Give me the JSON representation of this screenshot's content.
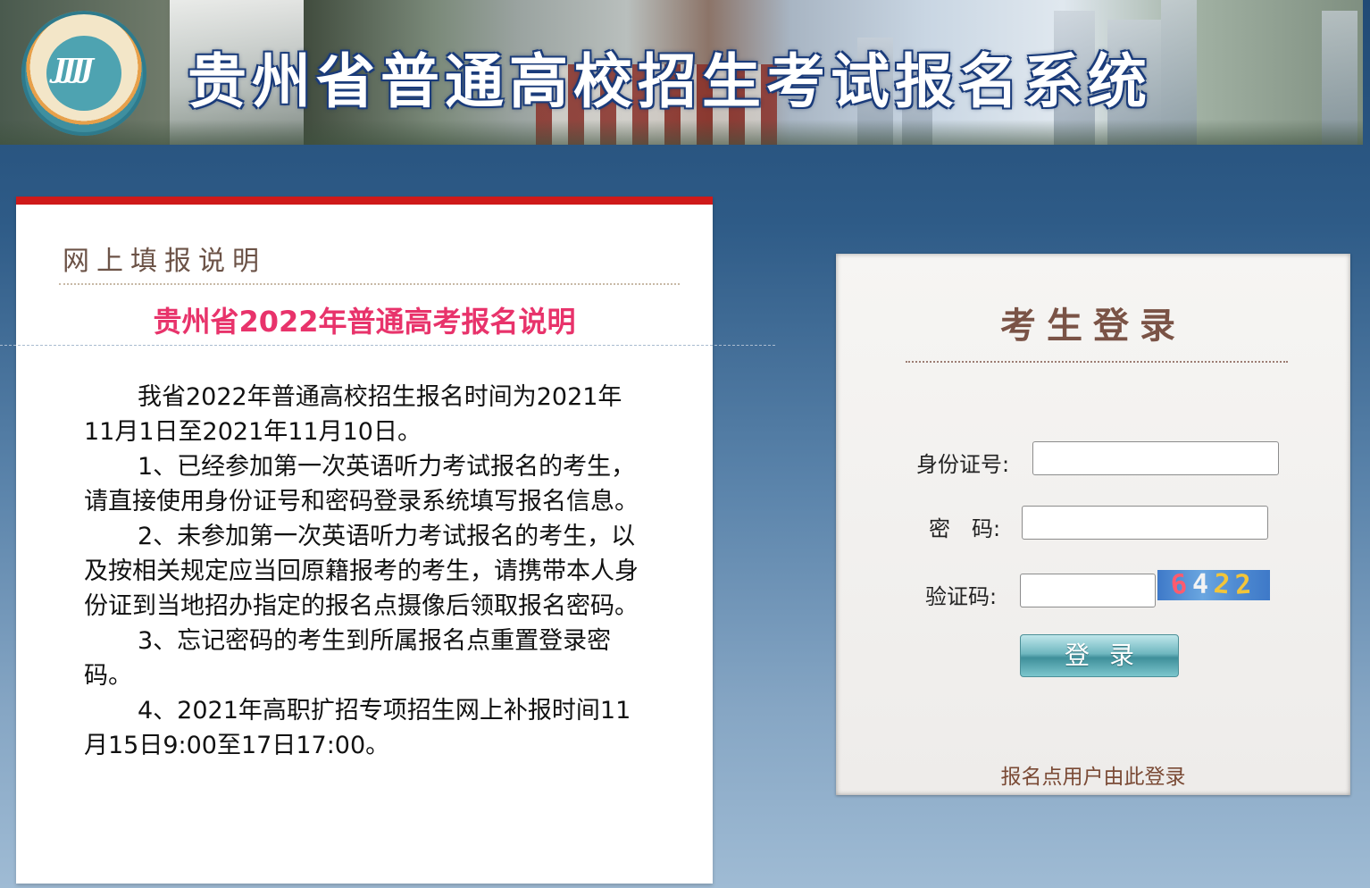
{
  "banner": {
    "title": "贵州省普通高校招生考试报名系统",
    "logo_icon": "guizhou-exam-logo"
  },
  "notice": {
    "header_label": "网上填报说明",
    "title": "贵州省2022年普通高考报名说明",
    "paragraphs": [
      "我省2022年普通高校招生报名时间为2021年11月1日至2021年11月10日。",
      "1、已经参加第一次英语听力考试报名的考生，请直接使用身份证号和密码登录系统填写报名信息。",
      "2、未参加第一次英语听力考试报名的考生，以及按相关规定应当回原籍报考的考生，请携带本人身份证到当地招办指定的报名点摄像后领取报名密码。",
      "3、忘记密码的考生到所属报名点重置登录密码。",
      "4、2021年高职扩招专项招生网上补报时间11月15日9:00至17日17:00。"
    ],
    "accent_color": "#cf1a1a",
    "title_color": "#e8336b"
  },
  "login": {
    "title": "考生登录",
    "id_label": "身份证号:",
    "id_value": "",
    "password_label": "密　码:",
    "password_value": "",
    "captcha_label": "验证码:",
    "captcha_value": "",
    "captcha_digits": [
      "6",
      "4",
      "2",
      "2"
    ],
    "submit_label": "登录",
    "site_login_link": "报名点用户由此登录"
  }
}
